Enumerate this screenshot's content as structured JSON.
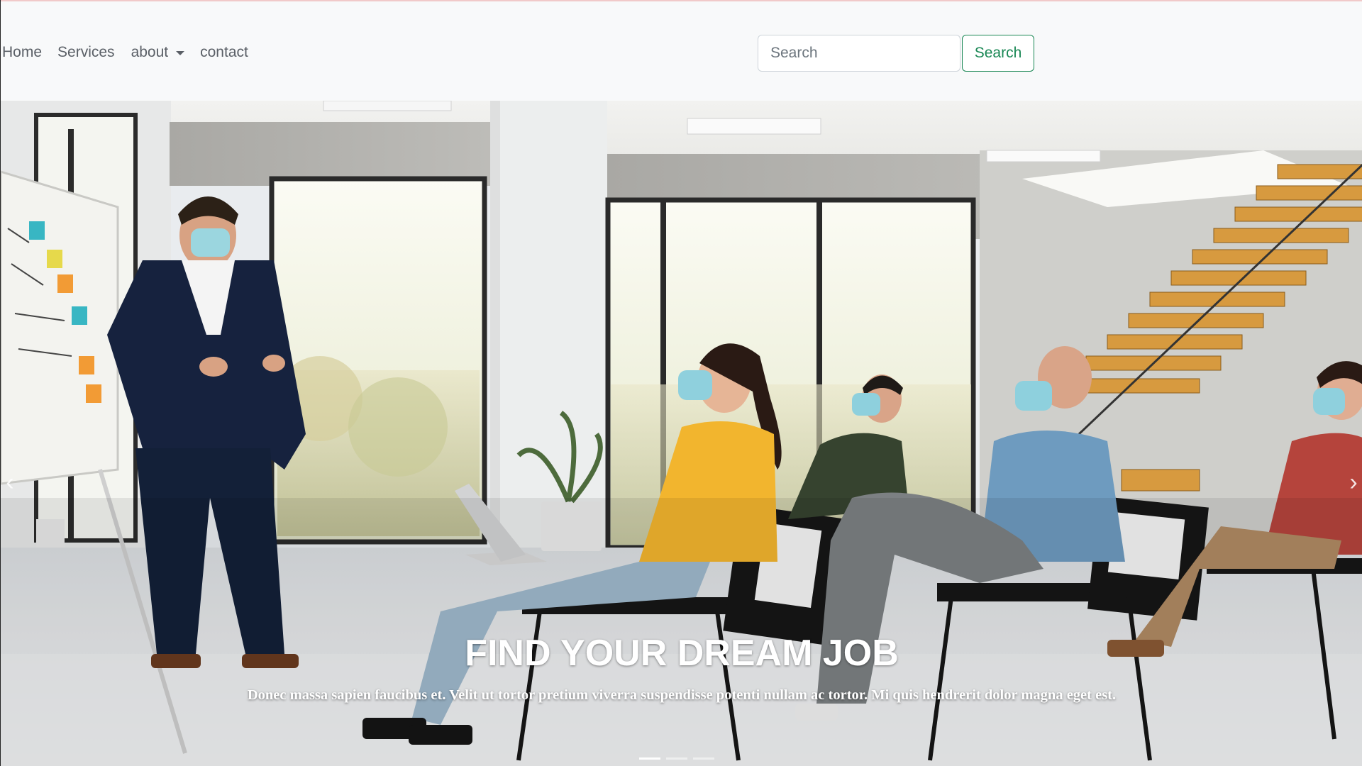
{
  "nav": {
    "home": "Home",
    "services": "Services",
    "about": "about",
    "contact": "contact"
  },
  "search": {
    "placeholder": "Search",
    "button_label": "Search"
  },
  "hero": {
    "title": "FIND YOUR DREAM JOB",
    "text": "Donec massa sapien faucibus et. Velit ut tortor pretium viverra suspendisse potenti nullam ac tortor. Mi quis hendrerit dolor magna eget est.",
    "prev_glyph": "‹",
    "next_glyph": "›",
    "slides": 3,
    "active_slide": 1
  },
  "colors": {
    "navbar_bg": "#f8f9fa",
    "nav_text": "#5a5f66",
    "search_accent": "#198754"
  }
}
